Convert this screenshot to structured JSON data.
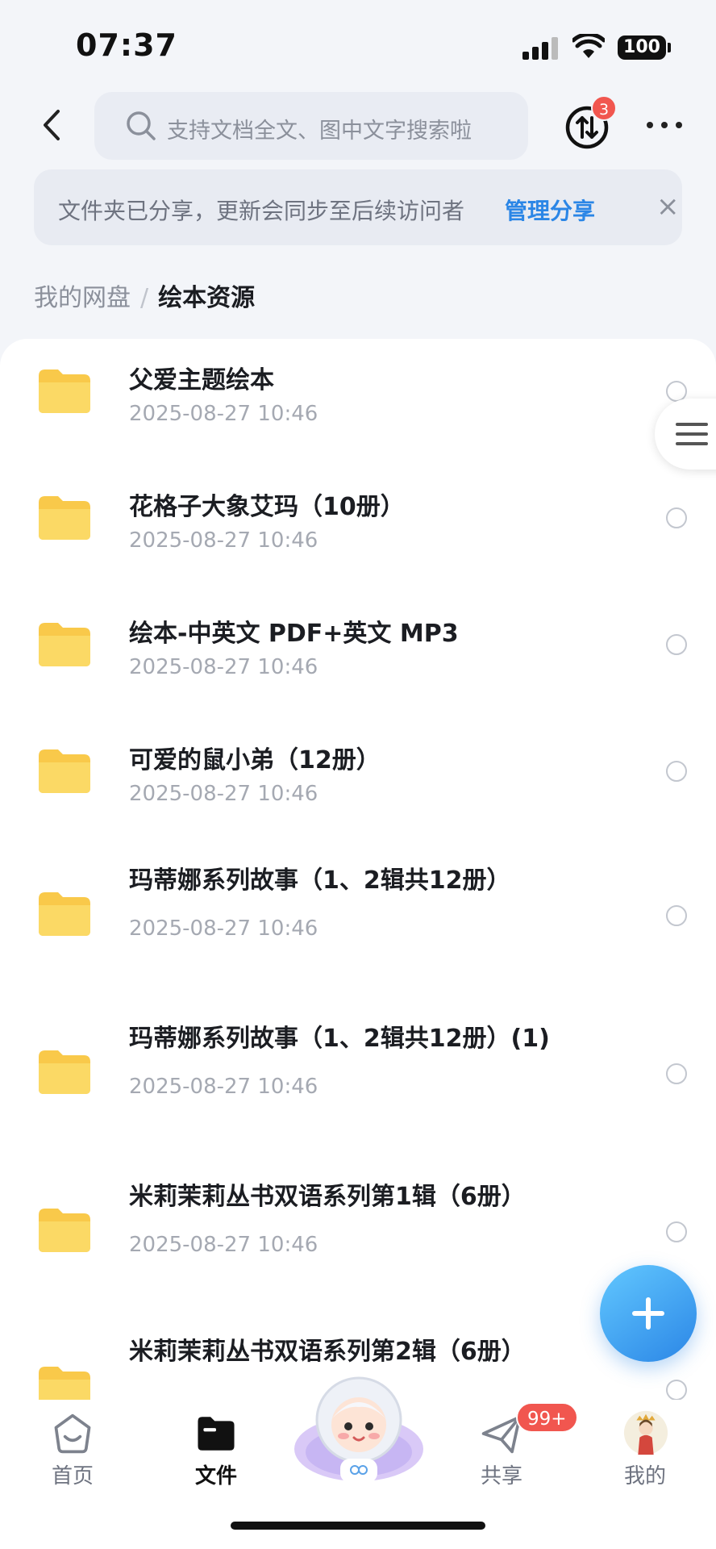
{
  "status_bar": {
    "time": "07:37",
    "battery": "100"
  },
  "header": {
    "search_placeholder": "支持文档全文、图中文字搜索啦",
    "transfer_badge": "3"
  },
  "share_notice": {
    "text": "文件夹已分享，更新会同步至后续访问者",
    "manage_label": "管理分享",
    "close_label": "×"
  },
  "breadcrumb": {
    "root": "我的网盘",
    "separator": "/",
    "current": "绘本资源"
  },
  "files": [
    {
      "name": "父爱主题绘本",
      "date": "2025-08-27 10:46"
    },
    {
      "name": "花格子大象艾玛（10册）",
      "date": "2025-08-27 10:46"
    },
    {
      "name": "绘本-中英文 PDF+英文 MP3",
      "date": "2025-08-27 10:46"
    },
    {
      "name": "可爱的鼠小弟（12册）",
      "date": "2025-08-27 10:46"
    },
    {
      "name": "玛蒂娜系列故事（1、2辑共12册）",
      "date": "2025-08-27 10:46"
    },
    {
      "name": "玛蒂娜系列故事（1、2辑共12册）(1)",
      "date": "2025-08-27 10:46"
    },
    {
      "name": "米莉茉莉丛书双语系列第1辑（6册）",
      "date": "2025-08-27 10:46"
    },
    {
      "name": "米莉茉莉丛书双语系列第2辑（6册）",
      "date": ""
    }
  ],
  "bottom_nav": {
    "items": [
      {
        "label": "首页"
      },
      {
        "label": "文件"
      },
      {
        "label": "共享"
      },
      {
        "label": "我的"
      }
    ],
    "share_badge": "99+"
  },
  "colors": {
    "accent": "#2b86e6",
    "badge": "#f1564f",
    "folder": "#f9c94a"
  }
}
